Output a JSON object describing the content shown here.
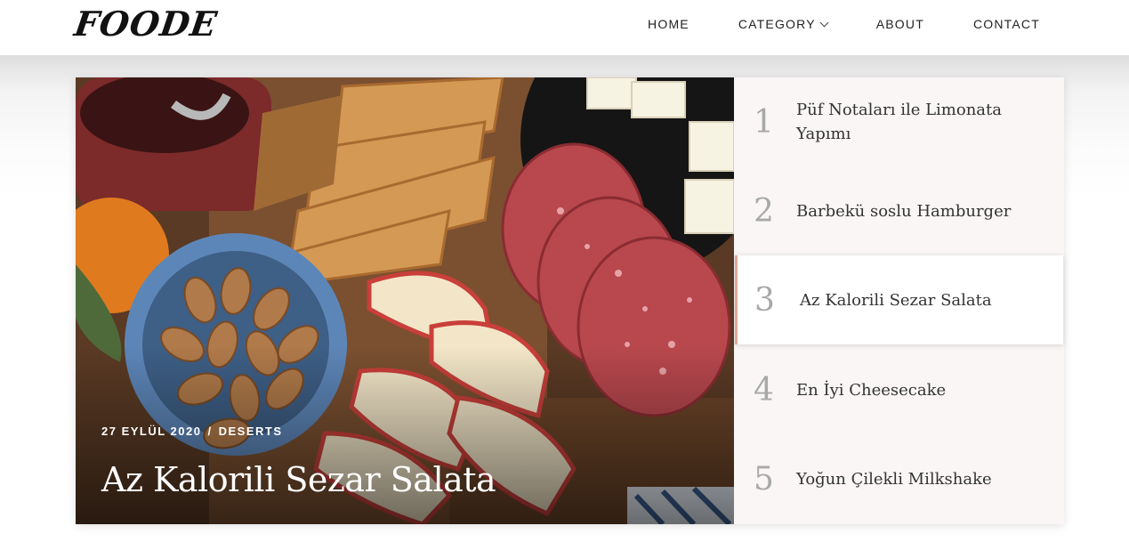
{
  "header": {
    "logo": "FOODE",
    "nav": [
      {
        "label": "HOME"
      },
      {
        "label": "CATEGORY"
      },
      {
        "label": "ABOUT"
      },
      {
        "label": "CONTACT"
      }
    ]
  },
  "featured": {
    "date": "27 EYLÜL 2020",
    "separator": "/",
    "category": "DESERTS",
    "title": "Az Kalorili Sezar Salata"
  },
  "posts": [
    {
      "number": "1",
      "title": "Püf Notaları ile Limonata Yapımı"
    },
    {
      "number": "2",
      "title": "Barbekü soslu Hamburger"
    },
    {
      "number": "3",
      "title": "Az Kalorili Sezar Salata"
    },
    {
      "number": "4",
      "title": "En İyi Cheesecake"
    },
    {
      "number": "5",
      "title": "Yoğun Çilekli Milkshake"
    }
  ],
  "colors": {
    "accent": "#e0a896",
    "list_background": "#f9f6f5",
    "number_gray": "#a8a8a8"
  }
}
